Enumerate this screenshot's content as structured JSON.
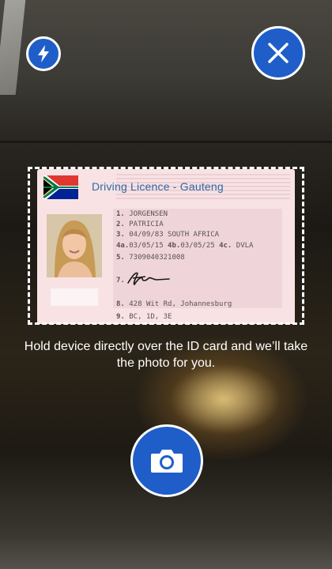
{
  "toolbar": {
    "flash_icon": "flash-icon",
    "close_icon": "close-icon"
  },
  "card": {
    "title": "Driving Licence - Gauteng",
    "fields": [
      {
        "num": "1.",
        "text": "JORGENSEN"
      },
      {
        "num": "2.",
        "text": "PATRICIA"
      },
      {
        "num": "3.",
        "text": "04/09/83 SOUTH AFRICA"
      },
      {
        "num": "4a.",
        "text": "03/05/15",
        "num2": "4b.",
        "text2": "03/05/25",
        "num3": "4c.",
        "text3": "DVLA"
      },
      {
        "num": "5.",
        "text": "7309040321008"
      },
      {
        "num": "7.",
        "text": ""
      },
      {
        "num": "8.",
        "text": "428  Wit Rd, Johannesburg"
      },
      {
        "num": "9.",
        "text": "BC, 1D, 3E"
      }
    ]
  },
  "instruction": "Hold device directly over the ID card and we’ll take the photo for you.",
  "capture": {
    "icon": "camera-icon"
  },
  "colors": {
    "accent": "#1f5ec9",
    "card": "#f8e2e4",
    "title": "#2c6aa8"
  }
}
